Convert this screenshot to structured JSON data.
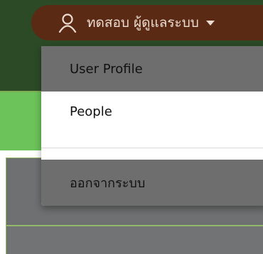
{
  "header": {
    "user_name": "ทดสอบ ผู้ดูแลระบบ",
    "user_icon": "user-icon",
    "caret_icon": "caret-down-icon"
  },
  "user_menu": {
    "items": [
      {
        "label": "User Profile"
      },
      {
        "label": "People"
      },
      {
        "label": "ออกจากระบบ"
      }
    ]
  },
  "colors": {
    "top_bar": "#2c4a26",
    "pill": "#5b2a14",
    "green_band": "#6cc35a",
    "menu_highlight": "#6e6e6e",
    "backdrop_grey": "#6f7071"
  }
}
